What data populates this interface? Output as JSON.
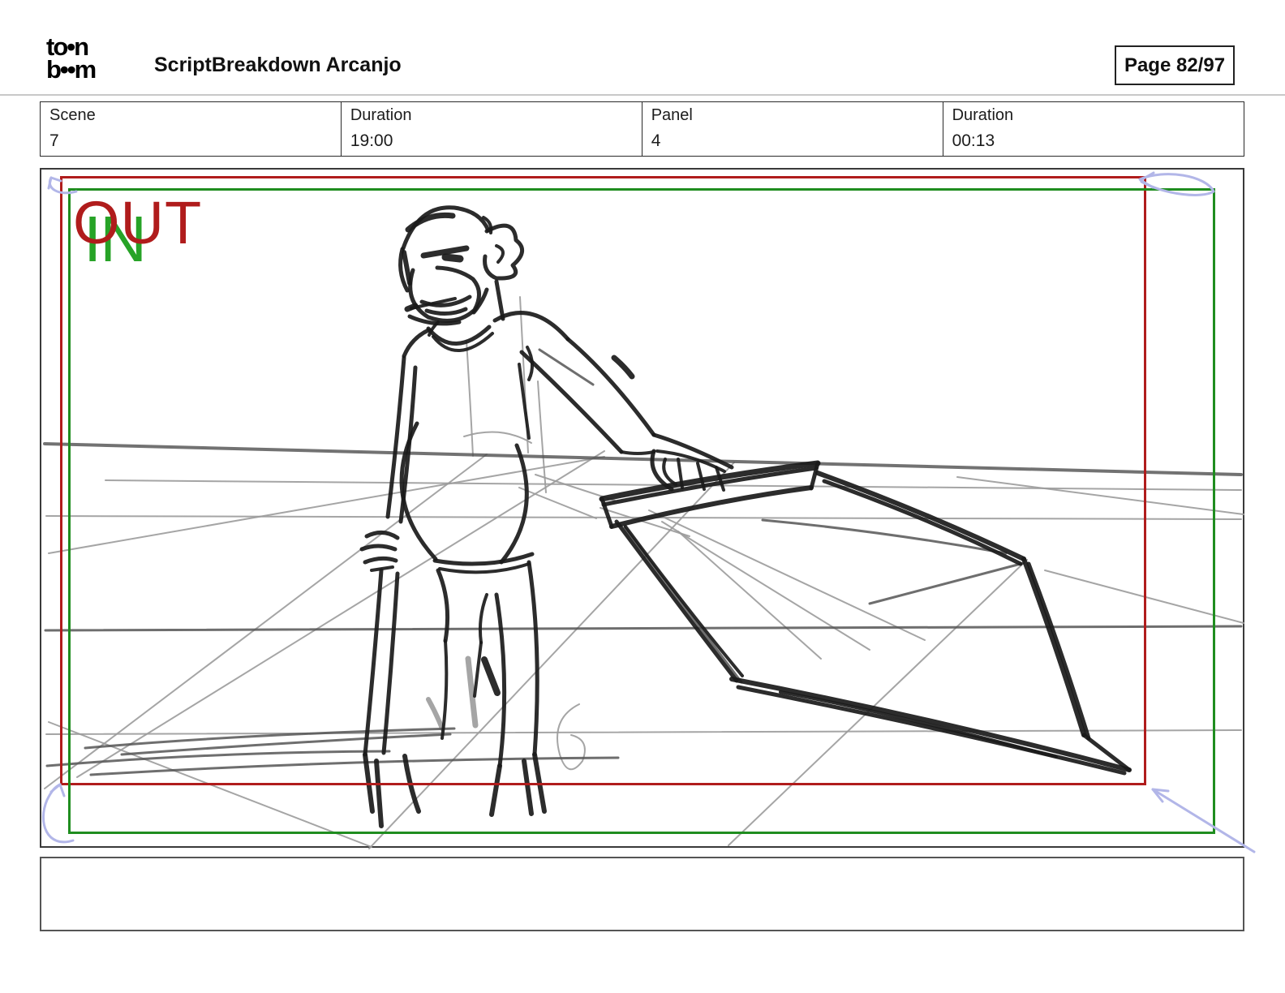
{
  "header": {
    "logo": {
      "top": "to•n",
      "bottom": "b••m"
    },
    "title": "ScriptBreakdown Arcanjo",
    "page_label": "Page 82/97"
  },
  "info": {
    "cells": [
      {
        "label": "Scene",
        "value": "7"
      },
      {
        "label": "Duration",
        "value": "19:00"
      },
      {
        "label": "Panel",
        "value": "4"
      },
      {
        "label": "Duration",
        "value": "00:13"
      }
    ]
  },
  "panel": {
    "in_label": "IN",
    "out_label": "OUT"
  },
  "caption": {
    "text": ""
  },
  "colors": {
    "out_frame": "#b01c1c",
    "in_frame": "#1f8d1f",
    "out_label": "#b01c1c",
    "in_label": "#27a327",
    "camera_arrow": "#b2b6e8",
    "pencil_dark": "#1a1a1a",
    "pencil_light": "#9b9b9b"
  }
}
